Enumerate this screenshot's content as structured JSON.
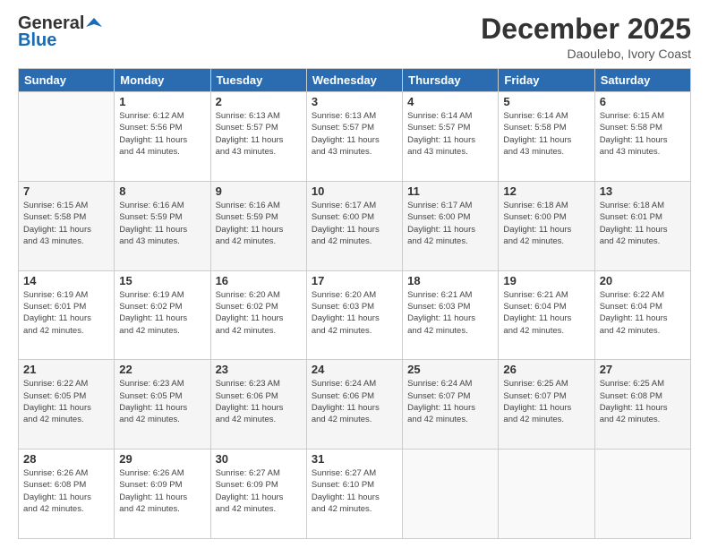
{
  "logo": {
    "line1": "General",
    "line2": "Blue"
  },
  "header": {
    "month": "December 2025",
    "location": "Daoulebo, Ivory Coast"
  },
  "days_of_week": [
    "Sunday",
    "Monday",
    "Tuesday",
    "Wednesday",
    "Thursday",
    "Friday",
    "Saturday"
  ],
  "weeks": [
    [
      {
        "day": "",
        "sunrise": "",
        "sunset": "",
        "daylight": ""
      },
      {
        "day": "1",
        "sunrise": "Sunrise: 6:12 AM",
        "sunset": "Sunset: 5:56 PM",
        "daylight": "Daylight: 11 hours and 44 minutes."
      },
      {
        "day": "2",
        "sunrise": "Sunrise: 6:13 AM",
        "sunset": "Sunset: 5:57 PM",
        "daylight": "Daylight: 11 hours and 43 minutes."
      },
      {
        "day": "3",
        "sunrise": "Sunrise: 6:13 AM",
        "sunset": "Sunset: 5:57 PM",
        "daylight": "Daylight: 11 hours and 43 minutes."
      },
      {
        "day": "4",
        "sunrise": "Sunrise: 6:14 AM",
        "sunset": "Sunset: 5:57 PM",
        "daylight": "Daylight: 11 hours and 43 minutes."
      },
      {
        "day": "5",
        "sunrise": "Sunrise: 6:14 AM",
        "sunset": "Sunset: 5:58 PM",
        "daylight": "Daylight: 11 hours and 43 minutes."
      },
      {
        "day": "6",
        "sunrise": "Sunrise: 6:15 AM",
        "sunset": "Sunset: 5:58 PM",
        "daylight": "Daylight: 11 hours and 43 minutes."
      }
    ],
    [
      {
        "day": "7",
        "sunrise": "Sunrise: 6:15 AM",
        "sunset": "Sunset: 5:58 PM",
        "daylight": "Daylight: 11 hours and 43 minutes."
      },
      {
        "day": "8",
        "sunrise": "Sunrise: 6:16 AM",
        "sunset": "Sunset: 5:59 PM",
        "daylight": "Daylight: 11 hours and 43 minutes."
      },
      {
        "day": "9",
        "sunrise": "Sunrise: 6:16 AM",
        "sunset": "Sunset: 5:59 PM",
        "daylight": "Daylight: 11 hours and 42 minutes."
      },
      {
        "day": "10",
        "sunrise": "Sunrise: 6:17 AM",
        "sunset": "Sunset: 6:00 PM",
        "daylight": "Daylight: 11 hours and 42 minutes."
      },
      {
        "day": "11",
        "sunrise": "Sunrise: 6:17 AM",
        "sunset": "Sunset: 6:00 PM",
        "daylight": "Daylight: 11 hours and 42 minutes."
      },
      {
        "day": "12",
        "sunrise": "Sunrise: 6:18 AM",
        "sunset": "Sunset: 6:00 PM",
        "daylight": "Daylight: 11 hours and 42 minutes."
      },
      {
        "day": "13",
        "sunrise": "Sunrise: 6:18 AM",
        "sunset": "Sunset: 6:01 PM",
        "daylight": "Daylight: 11 hours and 42 minutes."
      }
    ],
    [
      {
        "day": "14",
        "sunrise": "Sunrise: 6:19 AM",
        "sunset": "Sunset: 6:01 PM",
        "daylight": "Daylight: 11 hours and 42 minutes."
      },
      {
        "day": "15",
        "sunrise": "Sunrise: 6:19 AM",
        "sunset": "Sunset: 6:02 PM",
        "daylight": "Daylight: 11 hours and 42 minutes."
      },
      {
        "day": "16",
        "sunrise": "Sunrise: 6:20 AM",
        "sunset": "Sunset: 6:02 PM",
        "daylight": "Daylight: 11 hours and 42 minutes."
      },
      {
        "day": "17",
        "sunrise": "Sunrise: 6:20 AM",
        "sunset": "Sunset: 6:03 PM",
        "daylight": "Daylight: 11 hours and 42 minutes."
      },
      {
        "day": "18",
        "sunrise": "Sunrise: 6:21 AM",
        "sunset": "Sunset: 6:03 PM",
        "daylight": "Daylight: 11 hours and 42 minutes."
      },
      {
        "day": "19",
        "sunrise": "Sunrise: 6:21 AM",
        "sunset": "Sunset: 6:04 PM",
        "daylight": "Daylight: 11 hours and 42 minutes."
      },
      {
        "day": "20",
        "sunrise": "Sunrise: 6:22 AM",
        "sunset": "Sunset: 6:04 PM",
        "daylight": "Daylight: 11 hours and 42 minutes."
      }
    ],
    [
      {
        "day": "21",
        "sunrise": "Sunrise: 6:22 AM",
        "sunset": "Sunset: 6:05 PM",
        "daylight": "Daylight: 11 hours and 42 minutes."
      },
      {
        "day": "22",
        "sunrise": "Sunrise: 6:23 AM",
        "sunset": "Sunset: 6:05 PM",
        "daylight": "Daylight: 11 hours and 42 minutes."
      },
      {
        "day": "23",
        "sunrise": "Sunrise: 6:23 AM",
        "sunset": "Sunset: 6:06 PM",
        "daylight": "Daylight: 11 hours and 42 minutes."
      },
      {
        "day": "24",
        "sunrise": "Sunrise: 6:24 AM",
        "sunset": "Sunset: 6:06 PM",
        "daylight": "Daylight: 11 hours and 42 minutes."
      },
      {
        "day": "25",
        "sunrise": "Sunrise: 6:24 AM",
        "sunset": "Sunset: 6:07 PM",
        "daylight": "Daylight: 11 hours and 42 minutes."
      },
      {
        "day": "26",
        "sunrise": "Sunrise: 6:25 AM",
        "sunset": "Sunset: 6:07 PM",
        "daylight": "Daylight: 11 hours and 42 minutes."
      },
      {
        "day": "27",
        "sunrise": "Sunrise: 6:25 AM",
        "sunset": "Sunset: 6:08 PM",
        "daylight": "Daylight: 11 hours and 42 minutes."
      }
    ],
    [
      {
        "day": "28",
        "sunrise": "Sunrise: 6:26 AM",
        "sunset": "Sunset: 6:08 PM",
        "daylight": "Daylight: 11 hours and 42 minutes."
      },
      {
        "day": "29",
        "sunrise": "Sunrise: 6:26 AM",
        "sunset": "Sunset: 6:09 PM",
        "daylight": "Daylight: 11 hours and 42 minutes."
      },
      {
        "day": "30",
        "sunrise": "Sunrise: 6:27 AM",
        "sunset": "Sunset: 6:09 PM",
        "daylight": "Daylight: 11 hours and 42 minutes."
      },
      {
        "day": "31",
        "sunrise": "Sunrise: 6:27 AM",
        "sunset": "Sunset: 6:10 PM",
        "daylight": "Daylight: 11 hours and 42 minutes."
      },
      {
        "day": "",
        "sunrise": "",
        "sunset": "",
        "daylight": ""
      },
      {
        "day": "",
        "sunrise": "",
        "sunset": "",
        "daylight": ""
      },
      {
        "day": "",
        "sunrise": "",
        "sunset": "",
        "daylight": ""
      }
    ]
  ]
}
